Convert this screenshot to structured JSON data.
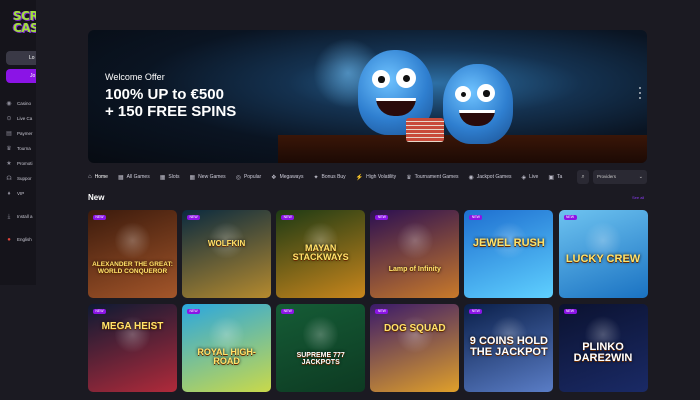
{
  "logo": {
    "line1": "SCR",
    "line2": "CAS"
  },
  "sidebar": {
    "login_label": "Lo",
    "join_label": "Jo",
    "items": [
      {
        "label": "Casino",
        "icon": "casino-icon"
      },
      {
        "label": "Live Ca",
        "icon": "live-casino-icon"
      },
      {
        "label": "Paymer",
        "icon": "payments-icon"
      },
      {
        "label": "Tourna",
        "icon": "tournaments-icon"
      },
      {
        "label": "Promoti",
        "icon": "promotions-icon"
      },
      {
        "label": "Suppor",
        "icon": "support-icon"
      },
      {
        "label": "VIP",
        "icon": "vip-icon"
      },
      {
        "label": "Install a",
        "icon": "install-icon"
      },
      {
        "label": "English",
        "icon": "language-icon"
      }
    ]
  },
  "hero": {
    "welcome": "Welcome Offer",
    "line1": "100% UP to €500",
    "line2": "+ 150 FREE SPINS"
  },
  "categories": [
    {
      "label": "Home",
      "icon": "home-icon",
      "active": true
    },
    {
      "label": "All Games",
      "icon": "grid-icon"
    },
    {
      "label": "Slots",
      "icon": "slots-icon"
    },
    {
      "label": "New Games",
      "icon": "new-games-icon"
    },
    {
      "label": "Popular",
      "icon": "popular-icon"
    },
    {
      "label": "Megaways",
      "icon": "megaways-icon"
    },
    {
      "label": "Bonus Buy",
      "icon": "bonus-buy-icon"
    },
    {
      "label": "High Volatility",
      "icon": "volatility-icon"
    },
    {
      "label": "Tournament Games",
      "icon": "tournament-icon"
    },
    {
      "label": "Jackpot Games",
      "icon": "jackpot-icon"
    },
    {
      "label": "Live",
      "icon": "live-icon"
    },
    {
      "label": "Ta",
      "icon": "table-icon"
    }
  ],
  "providers_label": "Providers",
  "section": {
    "title": "New",
    "see_all": "See all"
  },
  "new_badge": "NEW",
  "games": [
    {
      "title": "ALEXANDER THE GREAT: WORLD CONQUEROR",
      "colors": [
        "#3b1a0c",
        "#a4562a"
      ]
    },
    {
      "title": "WOLFKIN",
      "colors": [
        "#0a2a3f",
        "#b58a2e"
      ]
    },
    {
      "title": "MAYAN STACKWAYS",
      "colors": [
        "#1d3a14",
        "#c9861c"
      ]
    },
    {
      "title": "Lamp of Infinity",
      "colors": [
        "#2b0f52",
        "#c97a2a"
      ]
    },
    {
      "title": "JEWEL RUSH",
      "colors": [
        "#1e6fd0",
        "#5fd0ff"
      ]
    },
    {
      "title": "LUCKY CREW",
      "colors": [
        "#6ec3f0",
        "#1a72c2"
      ]
    },
    {
      "title": "MEGA HEIST",
      "colors": [
        "#0d1a33",
        "#b02a3a"
      ]
    },
    {
      "title": "ROYAL HIGH-ROAD",
      "colors": [
        "#2aa7e0",
        "#c9d94a"
      ]
    },
    {
      "title": "SUPREME 777 JACKPOTS",
      "colors": [
        "#155c36",
        "#0d3a22"
      ]
    },
    {
      "title": "DOG SQUAD",
      "colors": [
        "#3a1a6a",
        "#e0a02a"
      ]
    },
    {
      "title": "9 COINS HOLD THE JACKPOT",
      "colors": [
        "#0a1f4a",
        "#5a7dc6"
      ]
    },
    {
      "title": "PLINKO DARE2WIN",
      "colors": [
        "#0b1230",
        "#1a2a66"
      ]
    }
  ]
}
